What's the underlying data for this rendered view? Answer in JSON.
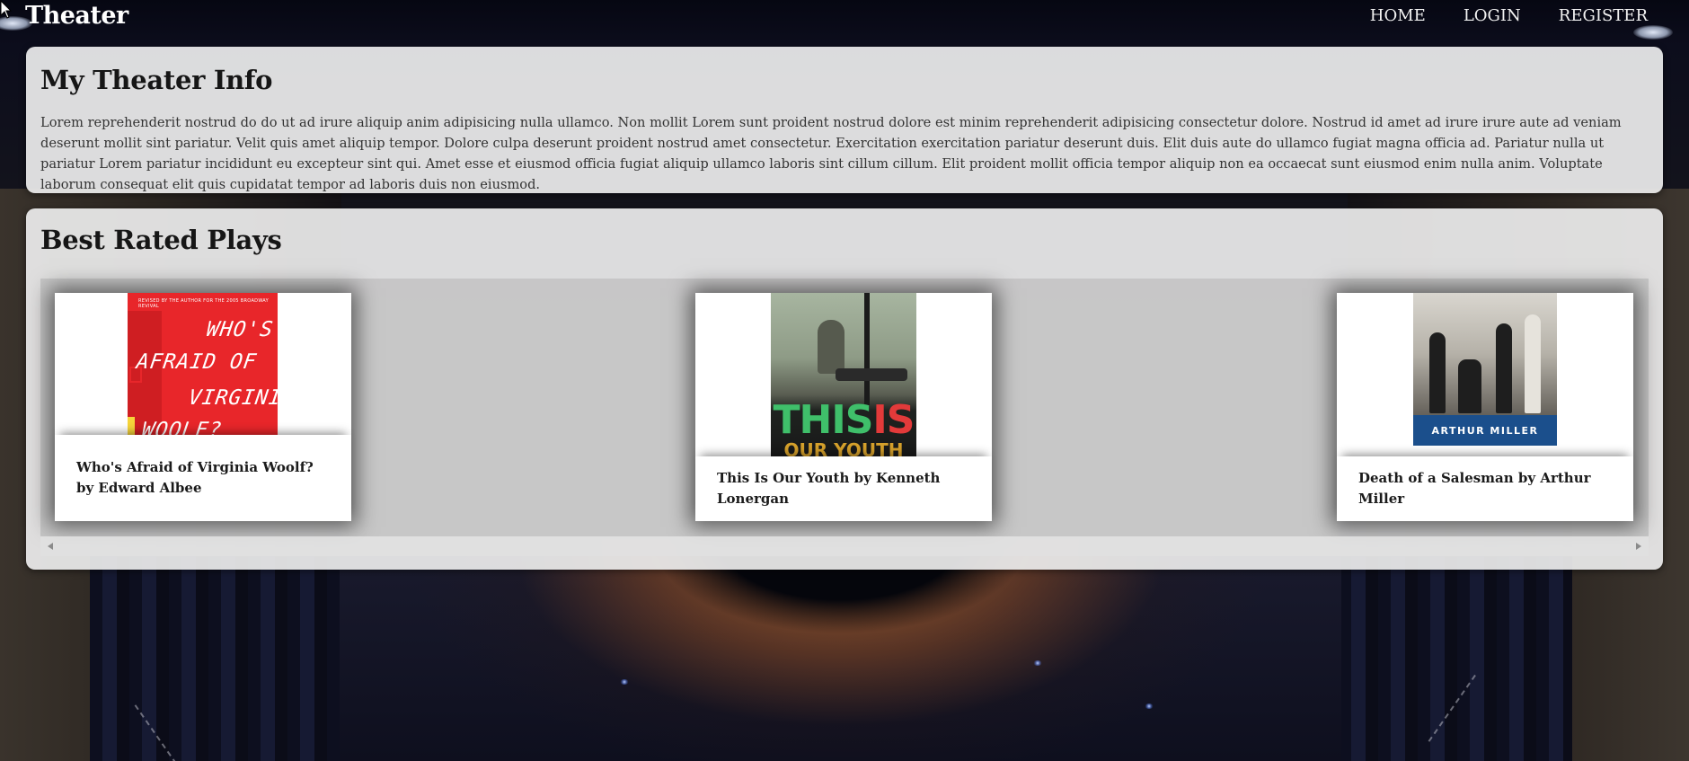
{
  "nav": {
    "brand": "Theater",
    "links": [
      {
        "label": "HOME"
      },
      {
        "label": "LOGIN"
      },
      {
        "label": "REGISTER"
      }
    ]
  },
  "info": {
    "title": "My Theater Info",
    "text": "Lorem reprehenderit nostrud do do ut ad irure aliquip anim adipisicing nulla ullamco. Non mollit Lorem sunt proident nostrud dolore est minim reprehenderit adipisicing consectetur dolore. Nostrud id amet ad irure irure aute ad veniam deserunt mollit sint pariatur. Velit quis amet aliquip tempor. Dolore culpa deserunt proident nostrud amet consectetur. Exercitation exercitation pariatur deserunt duis. Elit duis aute do ullamco fugiat magna officia ad. Pariatur nulla ut pariatur Lorem pariatur incididunt eu excepteur sint qui. Amet esse et eiusmod officia fugiat aliquip ullamco laboris sint cillum cillum. Elit proident mollit officia tempor aliquip non ea occaecat sunt eiusmod enim nulla anim. Voluptate laborum consequat elit quis cupidatat tempor ad laboris duis non eiusmod."
  },
  "plays": {
    "title": "Best Rated Plays",
    "items": [
      {
        "label": "Who's Afraid of Virginia Woolf? by Edward Albee",
        "cover": {
          "tagline": "REVISED BY THE AUTHOR FOR THE 2005 BROADWAY REVIVAL",
          "line1": "WHO'S",
          "line2": "AFRAID OF",
          "line3": "VIRGINIA",
          "line4": "WOOLF?"
        }
      },
      {
        "label": "This Is Our Youth by Kenneth Lonergan",
        "cover": {
          "word1": "THIS",
          "word2": "IS",
          "line2": "OUR YOUTH"
        }
      },
      {
        "label": "Death of a Salesman by Arthur Miller",
        "cover": {
          "author": "ARTHUR MILLER"
        }
      }
    ]
  },
  "colors": {
    "panel_bg": "#ececec",
    "woolf_red": "#e8262a",
    "salesman_blue": "#1b4f8c"
  }
}
